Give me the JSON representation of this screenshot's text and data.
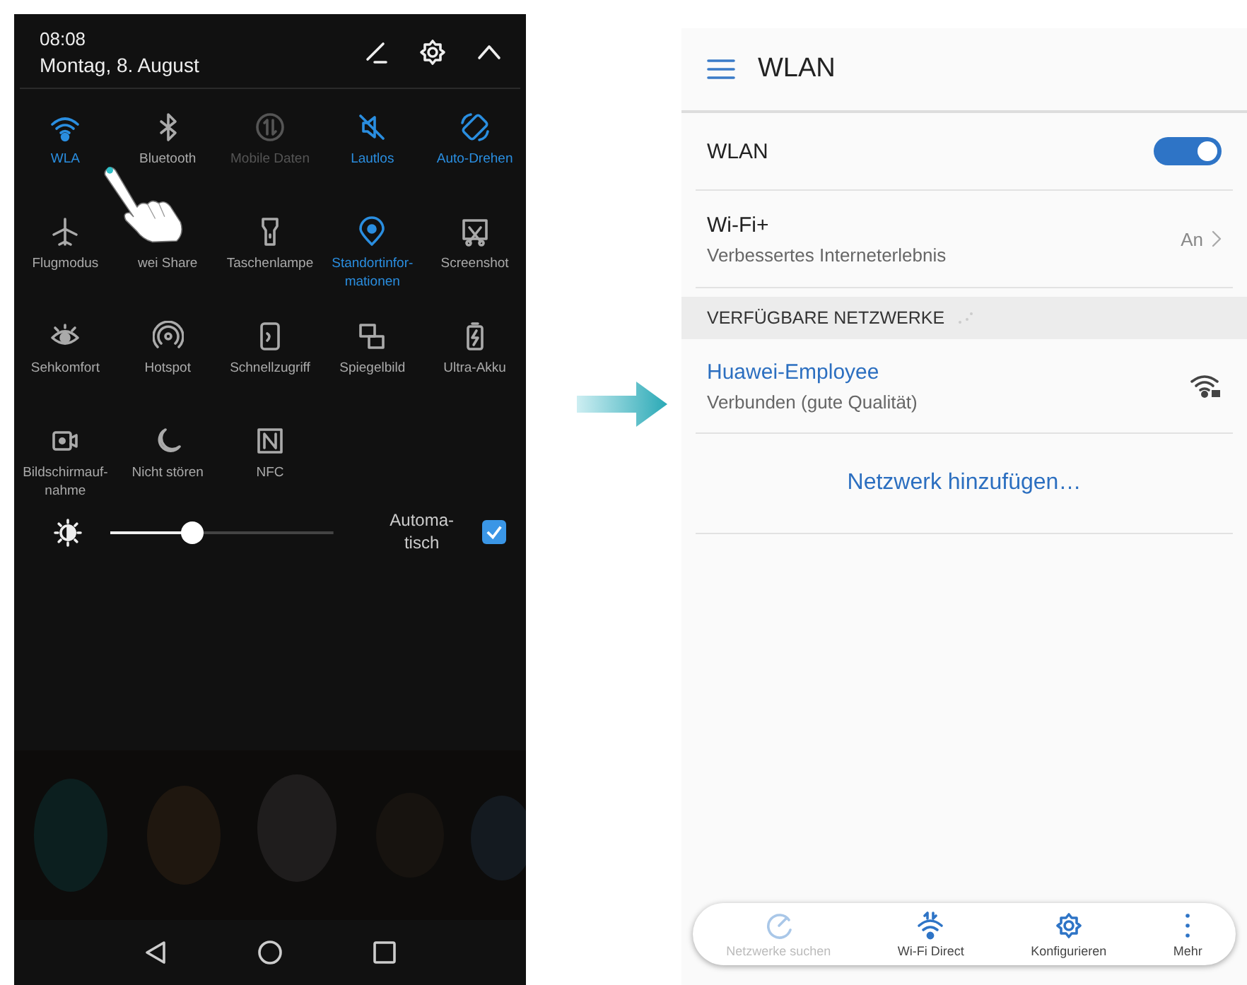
{
  "quick_panel": {
    "time": "08:08",
    "date": "Montag, 8. August",
    "tiles": [
      {
        "label": "WLA",
        "on": true,
        "disabled": false
      },
      {
        "label": "Bluetooth",
        "on": false,
        "disabled": false
      },
      {
        "label": "Mobile Daten",
        "on": false,
        "disabled": true
      },
      {
        "label": "Lautlos",
        "on": true,
        "disabled": false
      },
      {
        "label": "Auto-Drehen",
        "on": true,
        "disabled": false
      },
      {
        "label": "Flugmodus",
        "on": false,
        "disabled": false
      },
      {
        "label": "wei Share",
        "on": false,
        "disabled": false
      },
      {
        "label": "Taschenlampe",
        "on": false,
        "disabled": false
      },
      {
        "label": "Standortinfor-\nmationen",
        "on": true,
        "disabled": false
      },
      {
        "label": "Screenshot",
        "on": false,
        "disabled": false
      },
      {
        "label": "Sehkomfort",
        "on": false,
        "disabled": false
      },
      {
        "label": "Hotspot",
        "on": false,
        "disabled": false
      },
      {
        "label": "Schnellzugriff",
        "on": false,
        "disabled": false
      },
      {
        "label": "Spiegelbild",
        "on": false,
        "disabled": false
      },
      {
        "label": "Ultra-Akku",
        "on": false,
        "disabled": false
      },
      {
        "label": "Bildschirmauf-\nnahme",
        "on": false,
        "disabled": false
      },
      {
        "label": "Nicht stören",
        "on": false,
        "disabled": false
      },
      {
        "label": "NFC",
        "on": false,
        "disabled": false
      }
    ],
    "brightness": {
      "level": 0.37
    },
    "auto_brightness": {
      "label": "Automa-\ntisch",
      "checked": true
    }
  },
  "wlan_screen": {
    "title": "WLAN",
    "switch_row": {
      "label": "WLAN",
      "on": true
    },
    "wifi_plus": {
      "title": "Wi-Fi+",
      "subtitle": "Verbessertes Interneterlebnis",
      "value": "An"
    },
    "section_header": "VERFÜGBARE NETZWERKE",
    "networks": [
      {
        "name": "Huawei-Employee",
        "status": "Verbunden (gute Qualität)",
        "connected": true
      }
    ],
    "add_network": "Netzwerk hinzufügen…",
    "actions": [
      {
        "label": "Netzwerke suchen",
        "disabled": true
      },
      {
        "label": "Wi-Fi Direct",
        "disabled": false
      },
      {
        "label": "Konfigurieren",
        "disabled": false
      },
      {
        "label": "Mehr",
        "disabled": false
      }
    ]
  }
}
